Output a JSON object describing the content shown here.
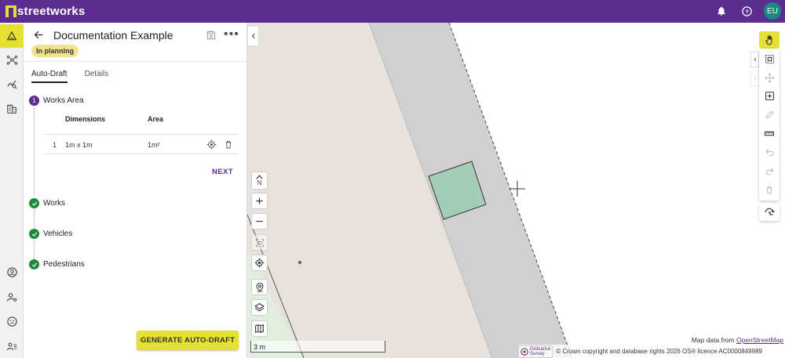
{
  "app": {
    "name": "streetworks",
    "user_initials": "EU",
    "colors": {
      "brand": "#5b2d91",
      "accent": "#e4e133",
      "success": "#1e8a3c",
      "status_planning": "#f3e28e"
    }
  },
  "topbar": {
    "icons": [
      "bell-icon",
      "help-icon"
    ]
  },
  "leftnav": {
    "items": [
      "works-icon",
      "network-icon",
      "analytics-icon",
      "buildings-icon",
      "profile-icon",
      "user-settings-icon",
      "support-icon",
      "team-icon"
    ]
  },
  "panel": {
    "title": "Documentation Example",
    "status": "In planning",
    "tabs": [
      {
        "label": "Auto-Draft",
        "active": true
      },
      {
        "label": "Details",
        "active": false
      }
    ],
    "steps": [
      {
        "number": "1",
        "label": "Works Area",
        "state": "current"
      },
      {
        "label": "Works",
        "state": "done"
      },
      {
        "label": "Vehicles",
        "state": "done"
      },
      {
        "label": "Pedestrians",
        "state": "done"
      }
    ],
    "table": {
      "headers": [
        "Dimensions",
        "Area"
      ],
      "rows": [
        {
          "index": "1",
          "dimensions": "1m x 1m",
          "area": "1m²"
        }
      ]
    },
    "next_label": "NEXT",
    "generate_label": "GENERATE AUTO-DRAFT"
  },
  "map": {
    "north_label": "N",
    "scale_label": "3 m",
    "attribution_prefix": "Map data from ",
    "attribution_link": "OpenStreetMap",
    "os_logo_line1": "Ordnance",
    "os_logo_line2": "Survey",
    "copyright": "© Crown copyright and database rights 2026 OS® licence AC0000849989"
  }
}
